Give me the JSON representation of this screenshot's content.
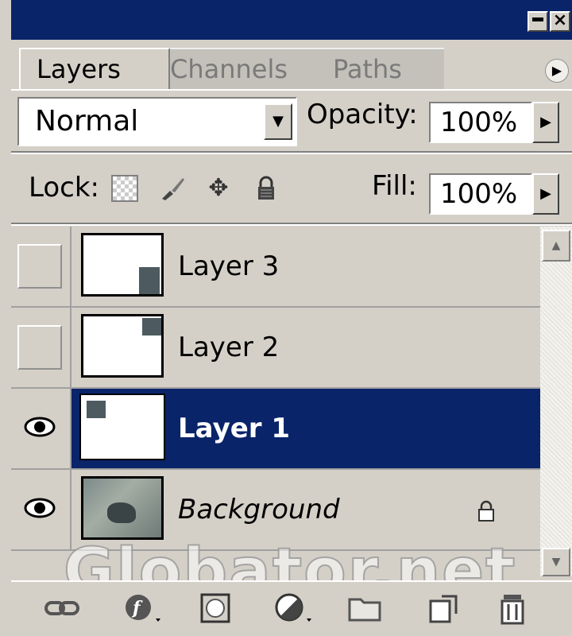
{
  "tabs": [
    {
      "label": "Layers",
      "active": true
    },
    {
      "label": "Channels",
      "active": false
    },
    {
      "label": "Paths",
      "active": false
    }
  ],
  "blend": {
    "mode": "Normal",
    "opacity_label": "Opacity:",
    "opacity_value": "100%"
  },
  "lock": {
    "label": "Lock:",
    "fill_label": "Fill:",
    "fill_value": "100%"
  },
  "layers": [
    {
      "name": "Layer 3",
      "visible": false,
      "selected": false
    },
    {
      "name": "Layer 2",
      "visible": false,
      "selected": false
    },
    {
      "name": "Layer 1",
      "visible": true,
      "selected": true
    },
    {
      "name": "Background",
      "visible": true,
      "selected": false,
      "locked": true
    }
  ],
  "watermark": "Globator.net",
  "colors": {
    "selection": "#0a246a",
    "panel": "#d4d0c8"
  },
  "toolbar_icons": [
    "link-icon",
    "layer-style-icon",
    "mask-icon",
    "adjustment-icon",
    "folder-icon",
    "new-layer-icon",
    "trash-icon"
  ]
}
